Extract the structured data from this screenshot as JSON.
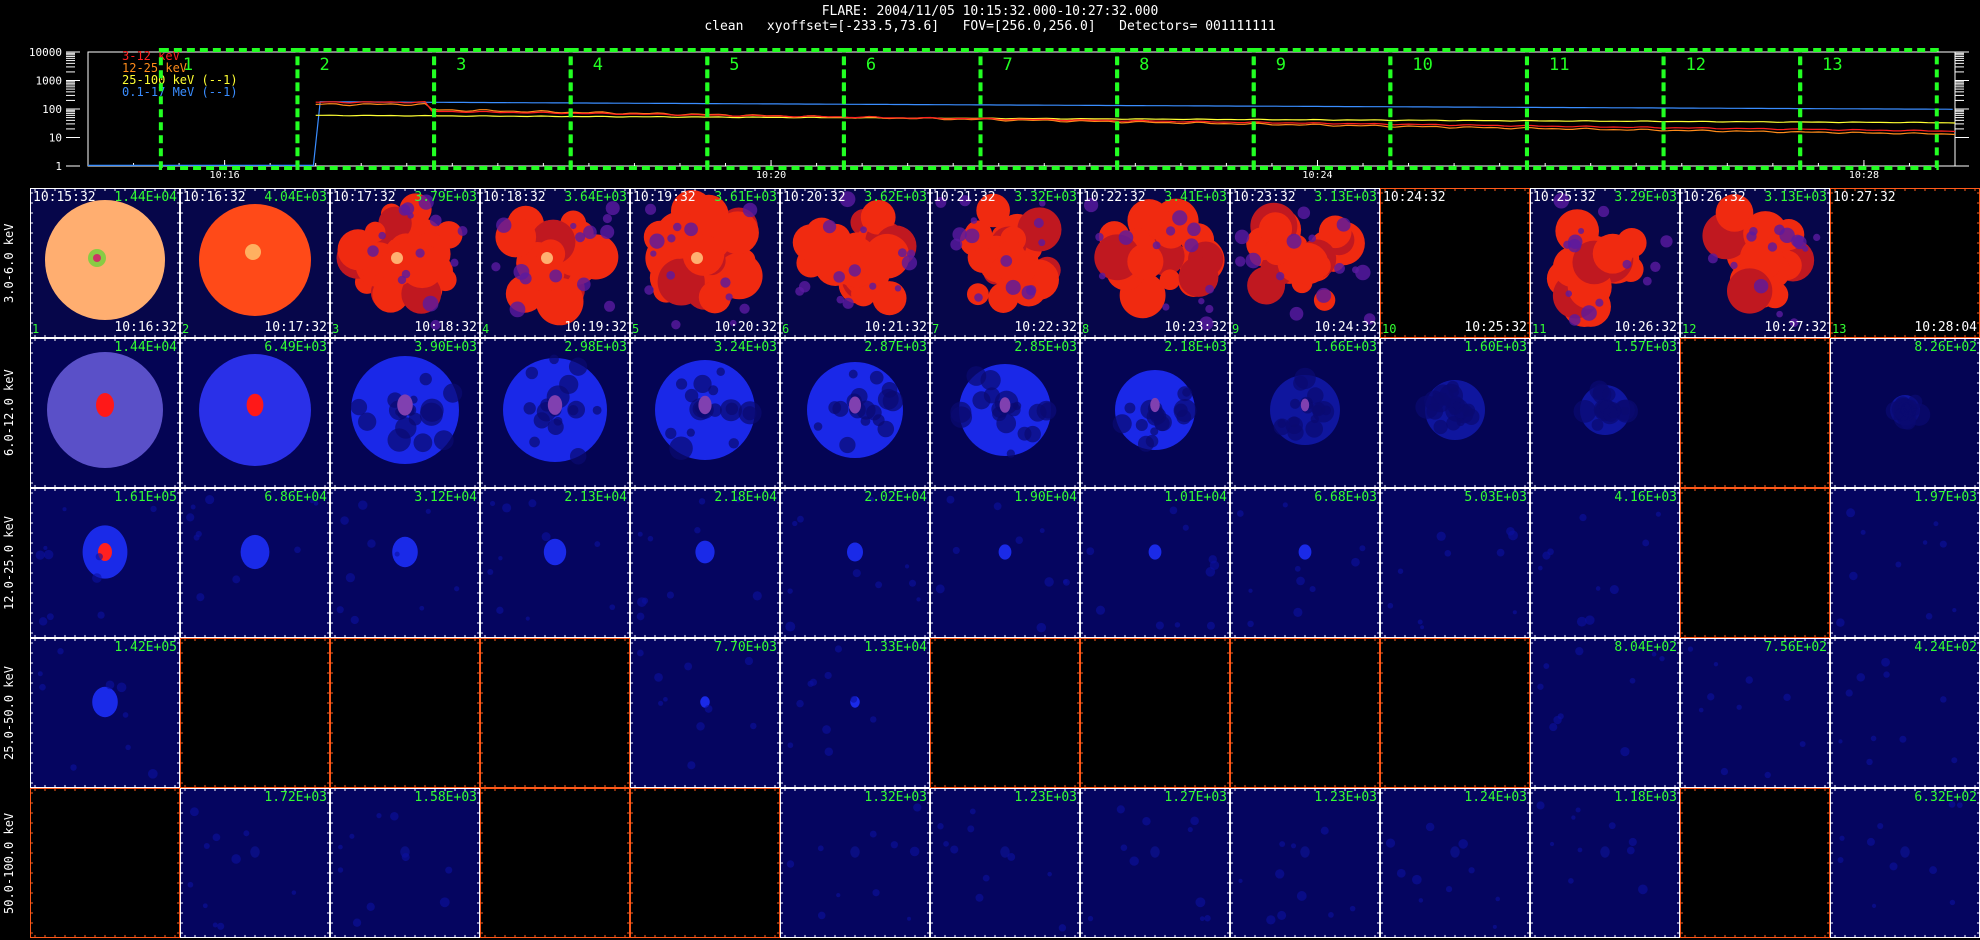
{
  "header": {
    "line1": "FLARE: 2004/11/05 10:15:32.000-10:27:32.000",
    "line2": "clean   xyoffset=[-233.5,73.6]   FOV=[256.0,256.0]   Detectors= 001111111"
  },
  "lightcurve": {
    "y_ticks": [
      "10000",
      "1000",
      "100",
      "10",
      "1"
    ],
    "x_ticks": [
      "10:16",
      "10:20",
      "10:24",
      "10:28"
    ],
    "legend": [
      {
        "label": "3-12 keV",
        "color": "#ff2020"
      },
      {
        "label": "12-25 keV",
        "color": "#ff8c1a"
      },
      {
        "label": "25-100 keV (--1)",
        "color": "#ffff33"
      },
      {
        "label": "0.1-17 MeV (--1)",
        "color": "#3a8dff"
      }
    ],
    "intervals": [
      "1",
      "2",
      "3",
      "4",
      "5",
      "6",
      "7",
      "8",
      "9",
      "10",
      "11",
      "12",
      "13"
    ],
    "interval_color": "#22ff22"
  },
  "energy_bands": [
    "3.0-6.0 keV",
    "6.0-12.0 keV",
    "12.0-25.0 keV",
    "25.0-50.0 keV",
    "50.0-100.0 keV"
  ],
  "times": {
    "start": [
      "10:15:32",
      "10:16:32",
      "10:17:32",
      "10:18:32",
      "10:19:32",
      "10:20:32",
      "10:21:32",
      "10:22:32",
      "10:23:32",
      "10:24:32",
      "10:25:32",
      "10:26:32",
      "10:27:32"
    ],
    "end": [
      "10:16:32",
      "10:17:32",
      "10:18:32",
      "10:19:32",
      "10:20:32",
      "10:21:32",
      "10:22:32",
      "10:23:32",
      "10:24:32",
      "10:25:32",
      "10:26:32",
      "10:27:32",
      "10:28:04"
    ],
    "index": [
      "1",
      "2",
      "3",
      "4",
      "5",
      "6",
      "7",
      "8",
      "9",
      "10",
      "11",
      "12",
      "13"
    ]
  },
  "peaks": [
    [
      "1.44E+04",
      "4.04E+03",
      "3.79E+03",
      "3.64E+03",
      "3.61E+03",
      "3.62E+03",
      "3.32E+03",
      "3.41E+03",
      "3.13E+03",
      "",
      "3.29E+03",
      "3.13E+03",
      ""
    ],
    [
      "1.44E+04",
      "6.49E+03",
      "3.90E+03",
      "2.98E+03",
      "3.24E+03",
      "2.87E+03",
      "2.85E+03",
      "2.18E+03",
      "1.66E+03",
      "1.60E+03",
      "1.57E+03",
      "",
      "8.26E+02"
    ],
    [
      "1.61E+05",
      "6.86E+04",
      "3.12E+04",
      "2.13E+04",
      "2.18E+04",
      "2.02E+04",
      "1.90E+04",
      "1.01E+04",
      "6.68E+03",
      "5.03E+03",
      "4.16E+03",
      "",
      "1.97E+03"
    ],
    [
      "1.42E+05",
      "",
      "",
      "",
      "7.70E+03",
      "1.33E+04",
      "",
      "",
      "",
      "",
      "8.04E+02",
      "7.56E+02",
      "4.24E+02"
    ],
    [
      "",
      "1.72E+03",
      "1.58E+03",
      "",
      "",
      "1.32E+03",
      "1.23E+03",
      "1.27E+03",
      "1.23E+03",
      "1.24E+03",
      "1.18E+03",
      "",
      "6.32E+02"
    ]
  ]
}
